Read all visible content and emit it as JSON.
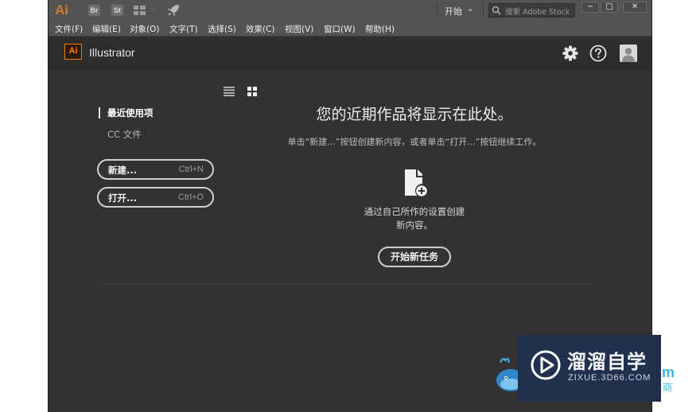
{
  "titlebar": {
    "logo": "Ai",
    "bridge": "Br",
    "stock": "St",
    "workspace": "开始",
    "search_placeholder": "搜索 Adobe Stock",
    "minimize": "−",
    "maximize": "□",
    "close": "✕"
  },
  "menu": [
    "文件(F)",
    "编辑(E)",
    "对象(O)",
    "文字(T)",
    "选择(S)",
    "效果(C)",
    "视图(V)",
    "窗口(W)",
    "帮助(H)"
  ],
  "header": {
    "badge": "Ai",
    "app_name": "Illustrator",
    "icons": [
      "gear-icon",
      "help-icon",
      "user-avatar-icon"
    ]
  },
  "left": {
    "recent": "最近使用项",
    "cc_files": "CC 文件",
    "new_label": "新建...",
    "new_shortcut": "Ctrl+N",
    "open_label": "打开...",
    "open_shortcut": "Ctrl+O"
  },
  "main": {
    "title": "您的近期作品将显示在此处。",
    "subtitle": "单击“新建...”按钮创建新内容，或者单击“打开...”按钮继续工作。",
    "create_line1": "通过自己所作的设置创建",
    "create_line2": "新内容。",
    "start_button": "开始新任务"
  },
  "watermark": {
    "title": "溜溜自学",
    "url": "ZIXUE.3D66.COM",
    "frag1": "m",
    "frag2": "商"
  },
  "colors": {
    "app_bg": "#323232",
    "bar_bg": "#535353",
    "header_bg": "#2d2d2d",
    "accent_orange": "#ff7c00",
    "watermark_bg": "#21314d",
    "watermark_blue": "#38b6e6"
  }
}
